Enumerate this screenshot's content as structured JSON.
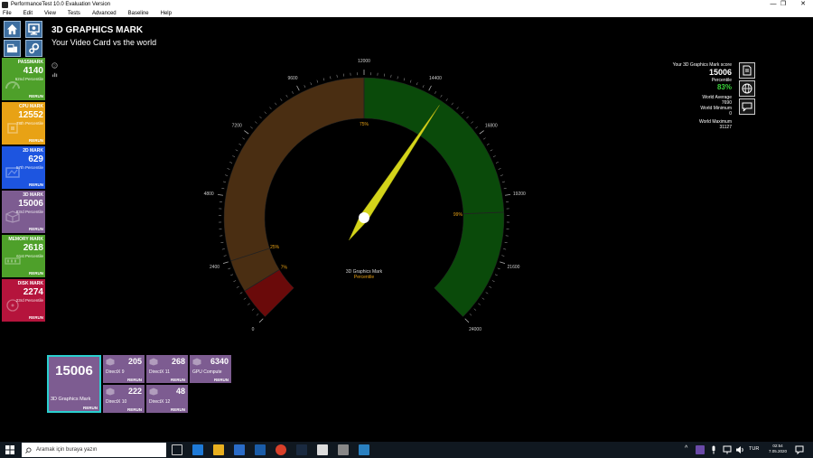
{
  "window": {
    "title": "PerformanceTest 10.0 Evaluation Version",
    "controls": [
      "—",
      "❐",
      "✕"
    ]
  },
  "menu": [
    "File",
    "Edit",
    "View",
    "Tests",
    "Advanced",
    "Baseline",
    "Help"
  ],
  "page": {
    "title": "3D GRAPHICS MARK",
    "subtitle": "Your Video Card vs the world"
  },
  "tiles": [
    {
      "name": "PASSMARK",
      "value": "4140",
      "percentile": "62nd Percentile",
      "rerun": "RERUN",
      "color": "#4ea02a"
    },
    {
      "name": "CPU MARK",
      "value": "12552",
      "percentile": "78th Percentile",
      "rerun": "RERUN",
      "color": "#e8a215"
    },
    {
      "name": "2D MARK",
      "value": "629",
      "percentile": "57th Percentile",
      "rerun": "RERUN",
      "color": "#1d55e0"
    },
    {
      "name": "3D MARK",
      "value": "15006",
      "percentile": "83rd Percentile",
      "rerun": "RERUN",
      "color": "#7d5c91"
    },
    {
      "name": "MEMORY MARK",
      "value": "2618",
      "percentile": "61st Percentile",
      "rerun": "RERUN",
      "color": "#4ea02a"
    },
    {
      "name": "DISK MARK",
      "value": "2274",
      "percentile": "23rd Percentile",
      "rerun": "RERUN",
      "color": "#b5143c"
    }
  ],
  "gauge": {
    "min": 0,
    "max": 24000,
    "value": 15006,
    "tick_labels": [
      "0",
      "2400",
      "4800",
      "7200",
      "9600",
      "12000",
      "14400",
      "16800",
      "19200",
      "21600",
      "24000"
    ],
    "bands": [
      {
        "from": 0,
        "to": 1200,
        "color": "#6a0a0a"
      },
      {
        "from": 1200,
        "to": 12000,
        "color": "#4a2e12"
      },
      {
        "from": 12000,
        "to": 24000,
        "color": "#0a4a0a"
      }
    ],
    "percentile_markers": [
      {
        "at": 1200,
        "label": "7%"
      },
      {
        "at": 2400,
        "label": "25%"
      },
      {
        "at": 12000,
        "label": "75%"
      },
      {
        "at": 19800,
        "label": "99%"
      }
    ],
    "center_label": "3D Graphics Mark",
    "center_sublabel": "Percentile",
    "marker_color": "#e8a215",
    "needle_color": "#d4d41a"
  },
  "summary": {
    "score_label": "Your 3D Graphics Mark score",
    "score": "15006",
    "percentile_label": "Percentile",
    "percentile": "83%",
    "world_average_label": "World Average",
    "world_average": "7690",
    "world_minimum_label": "World Minimum",
    "world_minimum": "0",
    "world_maximum_label": "World Maximum",
    "world_maximum": "31127",
    "accent": "#3ad43a"
  },
  "big_tile": {
    "value": "15006",
    "name": "3D Graphics Mark",
    "rerun": "RERUN"
  },
  "subtests": [
    {
      "value": "205",
      "name": "DirectX 9",
      "rerun": "RERUN"
    },
    {
      "value": "268",
      "name": "DirectX 11",
      "rerun": "RERUN"
    },
    {
      "value": "6340",
      "name": "GPU Compute",
      "rerun": "RERUN"
    },
    {
      "value": "222",
      "name": "DirectX 10",
      "rerun": "RERUN"
    },
    {
      "value": "48",
      "name": "DirectX 12",
      "rerun": "RERUN"
    }
  ],
  "taskbar": {
    "search_placeholder": "Aramak için buraya yazın",
    "language": "TUR",
    "time": "02:54",
    "date": "7.05.2020"
  }
}
